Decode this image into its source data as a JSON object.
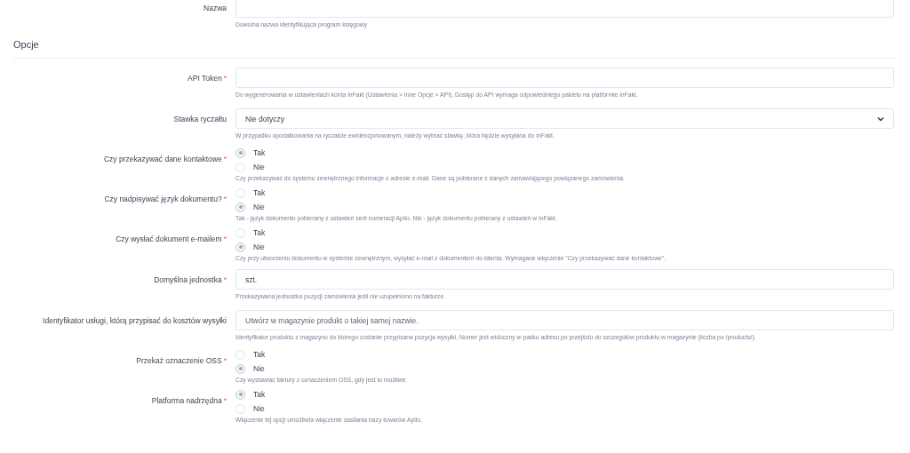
{
  "sections": [
    {
      "fields": [
        {
          "kind": "text",
          "label": "Nazwa",
          "help": "Dowolna nazwa identyfikująca program księgowy"
        }
      ]
    },
    {
      "title": "Opcje",
      "fields": [
        {
          "kind": "text",
          "label": "API Token",
          "required_mark": "*",
          "help": "Do wygenerowania w ustawieniach konta inFakt (Ustawienia > Inne Opcje > API). Dostęp do API wymaga odpowiedniego pakietu na platformie inFakt."
        },
        {
          "kind": "select",
          "label": "Stawka ryczałtu",
          "value": "Nie dotyczy",
          "help": "W przypadku opodatkowania na ryczałcie ewidencjonowanym, należy wybrać stawkę, która będzie wysyłana do InFakt."
        },
        {
          "kind": "radio",
          "label": "Czy przekazywać dane kontaktowe",
          "required_mark": "*",
          "options": [
            {
              "label": "Tak",
              "selected": true
            },
            {
              "label": "Nie",
              "selected": false
            }
          ],
          "help": "Czy przekazywać do systemu zewnętrznego informacje o adresie e-mail. Dane są pobierane z danych zamawiającego powiązanego zamówienia."
        },
        {
          "kind": "radio",
          "label": "Czy nadpisywać język dokumentu?",
          "required_mark": "*",
          "options": [
            {
              "label": "Tak",
              "selected": false
            },
            {
              "label": "Nie",
              "selected": true
            }
          ],
          "help": "Tak - język dokumentu pobierany z ustawień serii numeracji Apilo. Nie - język dokumentu pobierany z ustawień w inFakt."
        },
        {
          "kind": "radio",
          "label": "Czy wysłać dokument e-mailem",
          "required_mark": "*",
          "options": [
            {
              "label": "Tak",
              "selected": false
            },
            {
              "label": "Nie",
              "selected": true
            }
          ],
          "help": "Czy przy utworzeniu dokumentu w systemie zewnętrznym, wysyłać e-mail z dokumentem do klienta. Wymagane włączenie \"Czy przekazywać dane kontaktowe\"."
        },
        {
          "kind": "text",
          "label": "Domyślna jednostka",
          "required_mark": "*",
          "value": "szt.",
          "help": "Przekazywana jednostka pozycji zamówienia jeśli nie uzupełniono na fakturze."
        },
        {
          "kind": "text",
          "label": "Identyfikator usługi, którą przypisać do kosztów wysyłki",
          "placeholder": "Utwórz w magazynie produkt o takiej samej nazwie.",
          "help": "Identyfikator produktu z magazynu do którego zostanie przypisana pozycja wysyłki. Numer jest widoczny w pasku adresu po przejściu do szczegółów produktu w magazynie (liczba po /products/)."
        },
        {
          "kind": "radio",
          "label": "Przekaż oznaczenie OSS",
          "required_mark": "*",
          "options": [
            {
              "label": "Tak",
              "selected": false
            },
            {
              "label": "Nie",
              "selected": true
            }
          ],
          "help": "Czy wystawiać faktury z oznaczeniem OSS, gdy jest to możliwe"
        },
        {
          "kind": "radio",
          "label": "Platforma nadrzędna",
          "required_mark": "*",
          "options": [
            {
              "label": "Tak",
              "selected": true
            },
            {
              "label": "Nie",
              "selected": false
            }
          ],
          "help": "Włączenie tej opcji umożliwia włączenie zasilania bazy towarów Apilo."
        }
      ]
    }
  ]
}
